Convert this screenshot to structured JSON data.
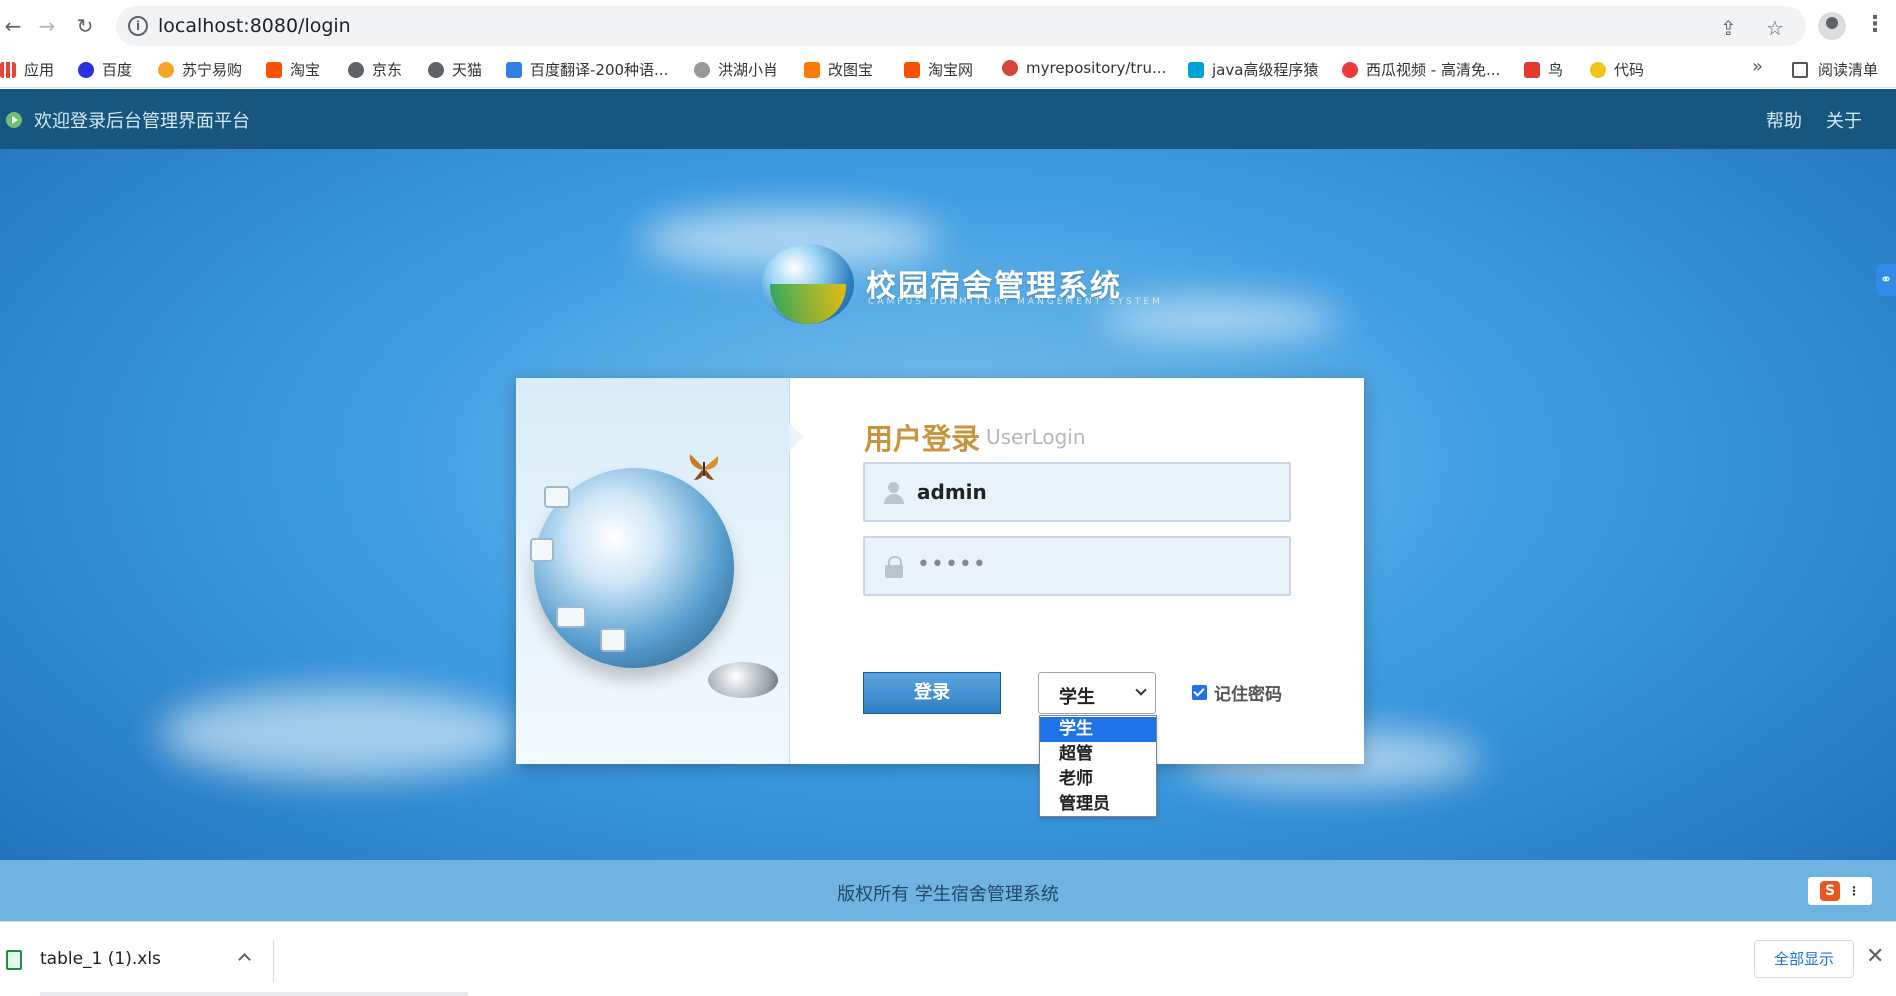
{
  "browser": {
    "url": "localhost:8080/login",
    "bookmarks": [
      {
        "label": "应用",
        "color": "#ea4335"
      },
      {
        "label": "百度",
        "color": "#2932e1"
      },
      {
        "label": "苏宁易购",
        "color": "#f5a623"
      },
      {
        "label": "淘宝",
        "color": "#ff5000"
      },
      {
        "label": "京东",
        "color": "#5f6368"
      },
      {
        "label": "天猫",
        "color": "#5f6368"
      },
      {
        "label": "百度翻译-200种语...",
        "color": "#2f7fe6"
      },
      {
        "label": "洪湖小肖",
        "color": "#999999"
      },
      {
        "label": "改图宝",
        "color": "#ff7a00"
      },
      {
        "label": "淘宝网",
        "color": "#ff5000"
      },
      {
        "label": "myrepository/tru...",
        "color": "#d4453a"
      },
      {
        "label": "java高级程序猿",
        "color": "#00a1d6"
      },
      {
        "label": "西瓜视频 - 高清免...",
        "color": "#f03a3a"
      },
      {
        "label": "鸟",
        "color": "#e33a2f"
      },
      {
        "label": "代码",
        "color": "#f0c419"
      }
    ],
    "reading_list": "阅读清单"
  },
  "header": {
    "welcome": "欢迎登录后台管理界面平台",
    "help": "帮助",
    "about": "关于"
  },
  "logo": {
    "title": "校园宿舍管理系统",
    "subtitle": "CAMPUS DORMITORY MANGEMENT SYSTEM"
  },
  "login": {
    "title": "用户登录",
    "title_en": "UserLogin",
    "username": "admin",
    "password_mask": "•••••",
    "submit": "登录",
    "role_selected": "学生",
    "role_options": [
      "学生",
      "超管",
      "老师",
      "管理员"
    ],
    "remember": "记住密码"
  },
  "footer": {
    "copyright": "版权所有 学生宿舍管理系统"
  },
  "downloads": {
    "file": "table_1 (1).xls",
    "show_all": "全部显示"
  }
}
